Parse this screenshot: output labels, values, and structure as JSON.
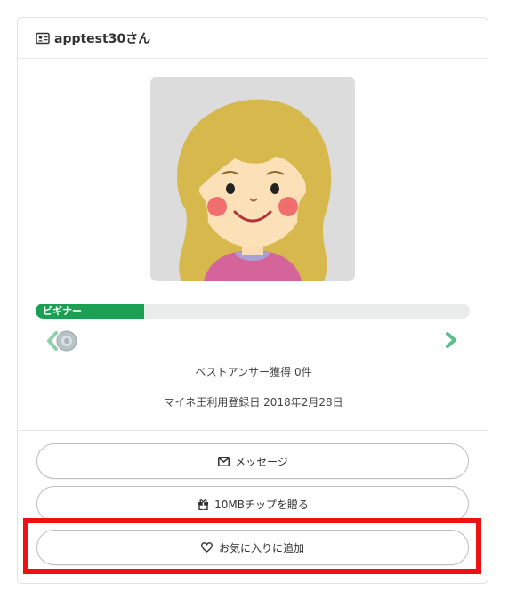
{
  "header": {
    "username": "apptest30さん"
  },
  "level": {
    "label": "ビギナー",
    "progress_percent": 25
  },
  "stats": {
    "best_answers": "ベストアンサー獲得 0件",
    "registration": "マイネ王利用登録日 2018年2月28日"
  },
  "actions": {
    "message": "メッセージ",
    "gift": "10MBチップを贈る",
    "favorite": "お気に入りに追加"
  },
  "colors": {
    "accent": "#1aa053",
    "highlight": "#ee1111"
  }
}
